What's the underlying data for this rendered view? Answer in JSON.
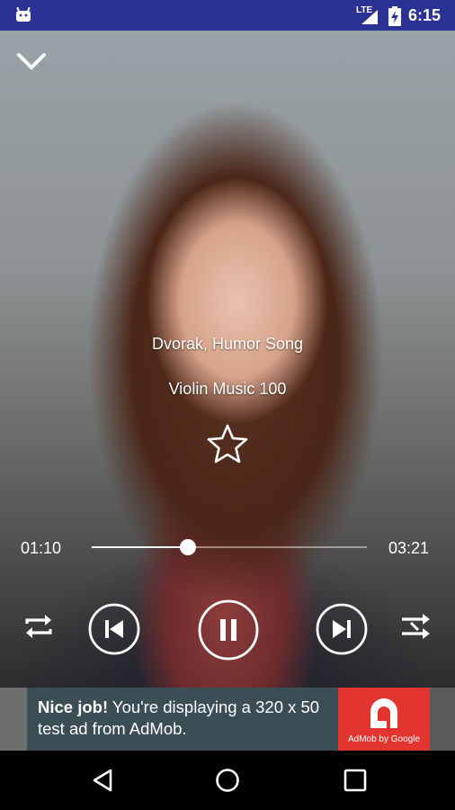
{
  "status_bar": {
    "network_label": "LTE",
    "time": "6:15"
  },
  "player": {
    "song_title": "Dvorak, Humor Song",
    "album_title": "Violin Music 100",
    "elapsed": "01:10",
    "total": "03:21",
    "progress_fraction": 0.35,
    "favorite": false
  },
  "controls": {
    "repeat_icon": "repeat-icon",
    "previous_icon": "skip-previous-icon",
    "pause_icon": "pause-icon",
    "next_icon": "skip-next-icon",
    "shuffle_icon": "shuffle-icon"
  },
  "ad": {
    "headline": "Nice job!",
    "body": " You're displaying a 320 x 50 test ad from AdMob.",
    "brand": "AdMob by Google",
    "brand_color": "#e3352f",
    "background_color": "#3b4e56"
  },
  "colors": {
    "status_bar": "#2b3296"
  }
}
